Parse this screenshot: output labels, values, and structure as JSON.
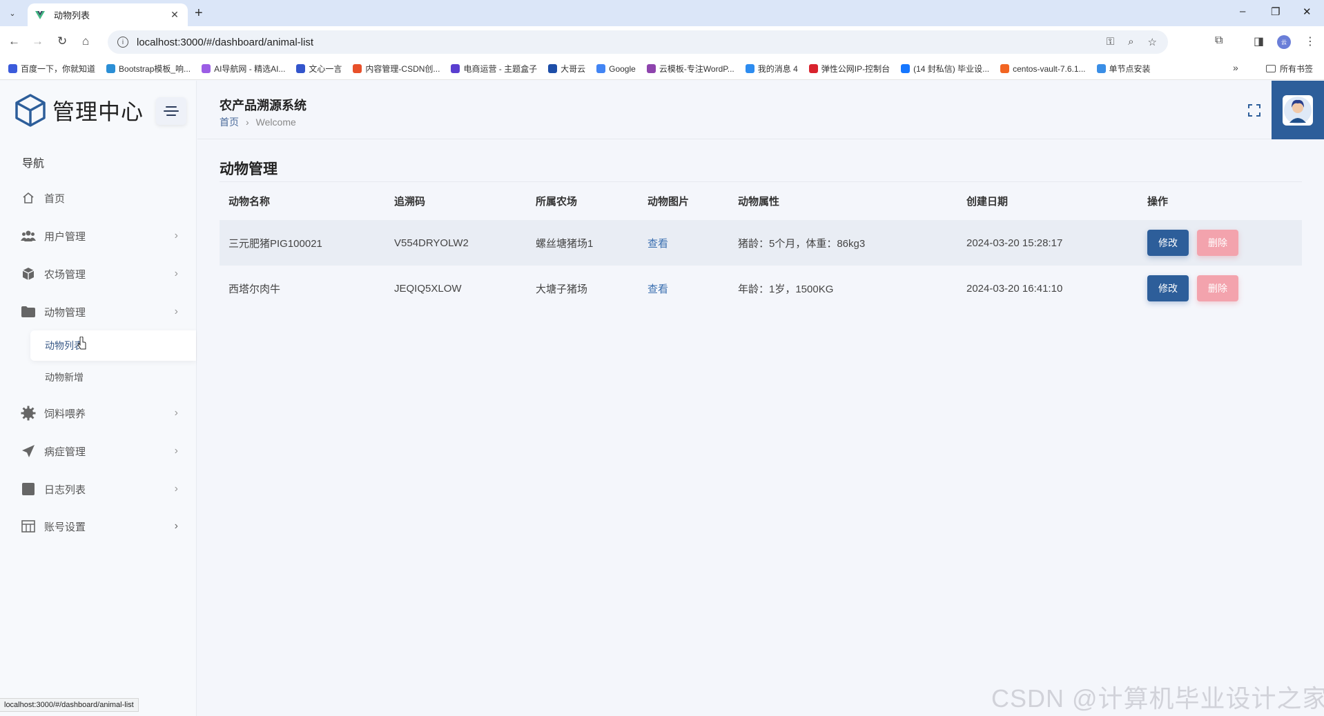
{
  "browser": {
    "tab_title": "动物列表",
    "url": "localhost:3000/#/dashboard/animal-list",
    "status_url": "localhost:3000/#/dashboard/animal-list",
    "bookmarks": [
      {
        "label": "百度一下，你就知道",
        "color": "#3b5bdb"
      },
      {
        "label": "Bootstrap模板_响...",
        "color": "#2b8fd6"
      },
      {
        "label": "AI导航网 - 精选AI...",
        "color": "#9b5de5"
      },
      {
        "label": "文心一言",
        "color": "#3355cc"
      },
      {
        "label": "内容管理-CSDN创...",
        "color": "#e8502a"
      },
      {
        "label": "电商运营 - 主题盒子",
        "color": "#5a3fd0"
      },
      {
        "label": "大哥云",
        "color": "#1d4ea8"
      },
      {
        "label": "Google",
        "color": "#4285f4"
      },
      {
        "label": "云模板-专注WordP...",
        "color": "#8e44ad"
      },
      {
        "label": "我的消息 4",
        "color": "#2d8cf0"
      },
      {
        "label": "弹性公网IP-控制台",
        "color": "#d9232d"
      },
      {
        "label": "(14 封私信) 毕业设...",
        "color": "#1677ff"
      },
      {
        "label": "centos-vault-7.6.1...",
        "color": "#f26522"
      },
      {
        "label": "单节点安装",
        "color": "#3a8ee6"
      }
    ],
    "all_bookmarks": "所有书签"
  },
  "sidebar": {
    "logo_text": "管理中心",
    "nav_heading": "导航",
    "items": [
      {
        "label": "首页",
        "icon": "home-icon"
      },
      {
        "label": "用户管理",
        "icon": "users-icon"
      },
      {
        "label": "农场管理",
        "icon": "cube-icon"
      },
      {
        "label": "动物管理",
        "icon": "folder-icon"
      },
      {
        "label": "饲料喂养",
        "icon": "gear-icon"
      },
      {
        "label": "病症管理",
        "icon": "send-icon"
      },
      {
        "label": "日志列表",
        "icon": "square-icon"
      },
      {
        "label": "账号设置",
        "icon": "table-icon"
      }
    ],
    "sub_items": [
      {
        "label": "动物列表"
      },
      {
        "label": "动物新增"
      }
    ]
  },
  "header": {
    "system_title": "农产品溯源系统",
    "breadcrumb_home": "首页",
    "breadcrumb_current": "Welcome"
  },
  "page": {
    "title": "动物管理",
    "columns": [
      "动物名称",
      "追溯码",
      "所属农场",
      "动物图片",
      "动物属性",
      "创建日期",
      "操作"
    ],
    "rows": [
      {
        "name": "三元肥猪PIG100021",
        "code": "V554DRYOLW2",
        "farm": "螺丝塘猪场1",
        "image_link": "查看",
        "attrs": "猪龄：5个月，体重：86kg3",
        "created": "2024-03-20 15:28:17",
        "edit": "修改",
        "delete": "删除"
      },
      {
        "name": "西塔尔肉牛",
        "code": "JEQIQ5XLOW",
        "farm": "大塘子猪场",
        "image_link": "查看",
        "attrs": "年龄：1岁，1500KG",
        "created": "2024-03-20 16:41:10",
        "edit": "修改",
        "delete": "删除"
      }
    ]
  },
  "watermark": "CSDN @计算机毕业设计之家",
  "colors": {
    "accent": "#2d5e9a",
    "danger": "#f3a3ad",
    "link": "#3a6fb0"
  }
}
